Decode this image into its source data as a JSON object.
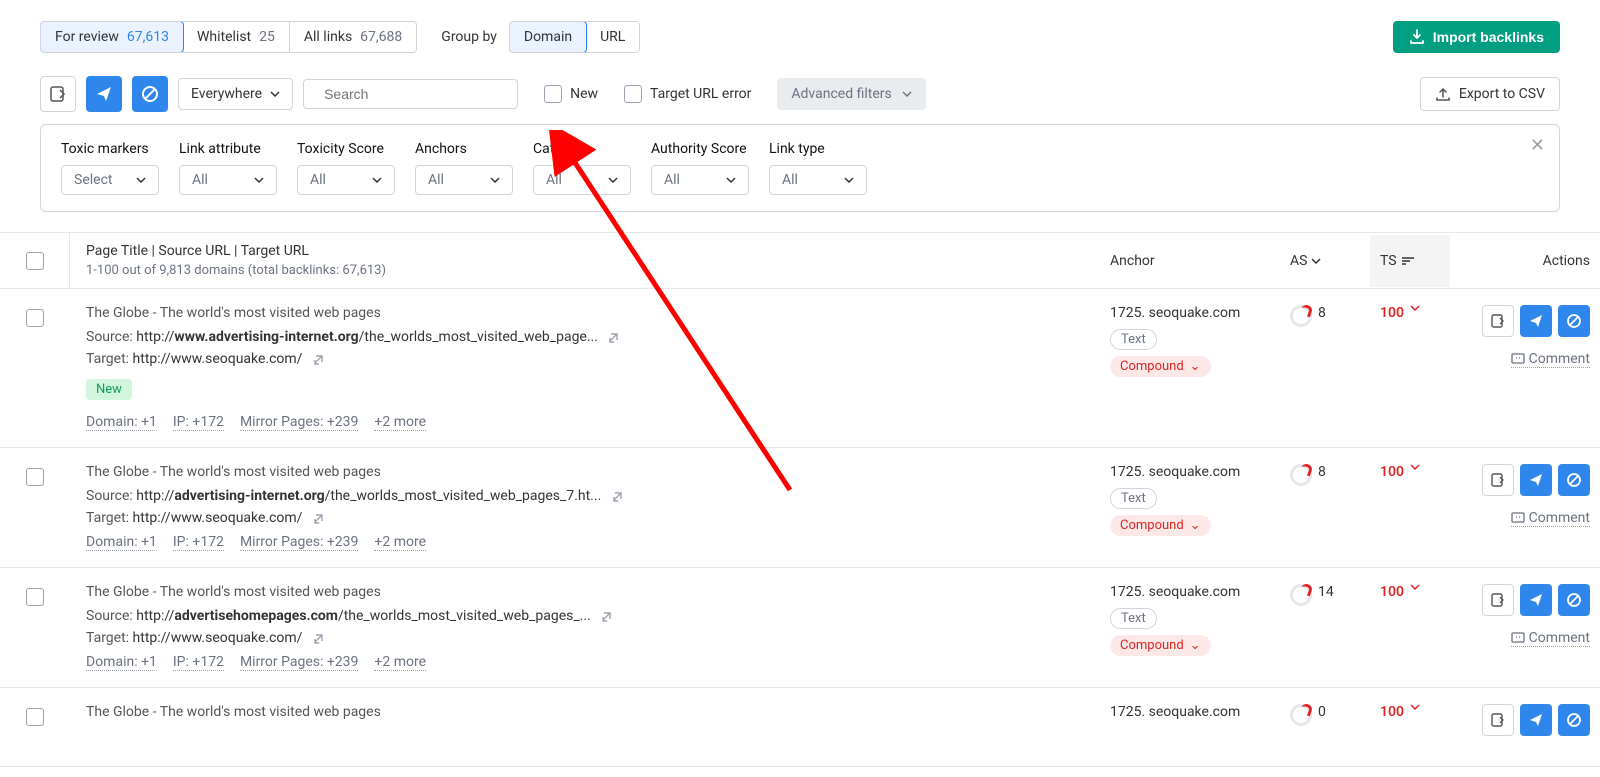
{
  "tabs": [
    {
      "label": "For review",
      "count": "67,613",
      "active": true
    },
    {
      "label": "Whitelist",
      "count": "25",
      "active": false
    },
    {
      "label": "All links",
      "count": "67,688",
      "active": false
    }
  ],
  "groupby": {
    "label": "Group by",
    "options": [
      {
        "label": "Domain",
        "active": true
      },
      {
        "label": "URL",
        "active": false
      }
    ]
  },
  "import_label": "Import backlinks",
  "toolbar": {
    "scope": "Everywhere",
    "search_placeholder": "Search",
    "new_label": "New",
    "target_err_label": "Target URL error",
    "adv_label": "Advanced filters",
    "export_label": "Export to CSV"
  },
  "filters": [
    {
      "label": "Toxic markers",
      "value": "Select"
    },
    {
      "label": "Link attribute",
      "value": "All"
    },
    {
      "label": "Toxicity Score",
      "value": "All"
    },
    {
      "label": "Anchors",
      "value": "All"
    },
    {
      "label": "Category",
      "value": "All"
    },
    {
      "label": "Authority Score",
      "value": "All"
    },
    {
      "label": "Link type",
      "value": "All"
    }
  ],
  "thead": {
    "main": "Page Title | Source URL | Target URL",
    "sub": "1-100 out of 9,813 domains (total backlinks: 67,613)",
    "anchor": "Anchor",
    "as": "AS",
    "ts": "TS",
    "actions": "Actions"
  },
  "rows": [
    {
      "title": "The Globe - The world's most visited web pages",
      "source_prefix": "http://",
      "source_bold": "www.advertising-internet.org",
      "source_rest": "/the_worlds_most_visited_web_page...",
      "target": "http://www.seoquake.com/",
      "new": true,
      "metrics": [
        "Domain: +1",
        "IP: +172",
        "Mirror Pages: +239",
        "+2 more"
      ],
      "anchor": "1725. seoquake.com",
      "badges": [
        "Text",
        "Compound"
      ],
      "as": "8",
      "ts": "100"
    },
    {
      "title": "The Globe - The world's most visited web pages",
      "source_prefix": "http://",
      "source_bold": "advertising-internet.org",
      "source_rest": "/the_worlds_most_visited_web_pages_7.ht...",
      "target": "http://www.seoquake.com/",
      "new": false,
      "metrics": [
        "Domain: +1",
        "IP: +172",
        "Mirror Pages: +239",
        "+2 more"
      ],
      "anchor": "1725. seoquake.com",
      "badges": [
        "Text",
        "Compound"
      ],
      "as": "8",
      "ts": "100"
    },
    {
      "title": "The Globe - The world's most visited web pages",
      "source_prefix": "http://",
      "source_bold": "advertisehomepages.com",
      "source_rest": "/the_worlds_most_visited_web_pages_...",
      "target": "http://www.seoquake.com/",
      "new": false,
      "metrics": [
        "Domain: +1",
        "IP: +172",
        "Mirror Pages: +239",
        "+2 more"
      ],
      "anchor": "1725. seoquake.com",
      "badges": [
        "Text",
        "Compound"
      ],
      "as": "14",
      "ts": "100"
    },
    {
      "title": "The Globe - The world's most visited web pages",
      "source_prefix": "",
      "source_bold": "",
      "source_rest": "",
      "target": "",
      "new": false,
      "metrics": [],
      "anchor": "1725. seoquake.com",
      "badges": [],
      "as": "0",
      "ts": "100"
    }
  ],
  "labels": {
    "source": "Source:",
    "target": "Target:",
    "comment": "Comment",
    "new_badge": "New"
  }
}
